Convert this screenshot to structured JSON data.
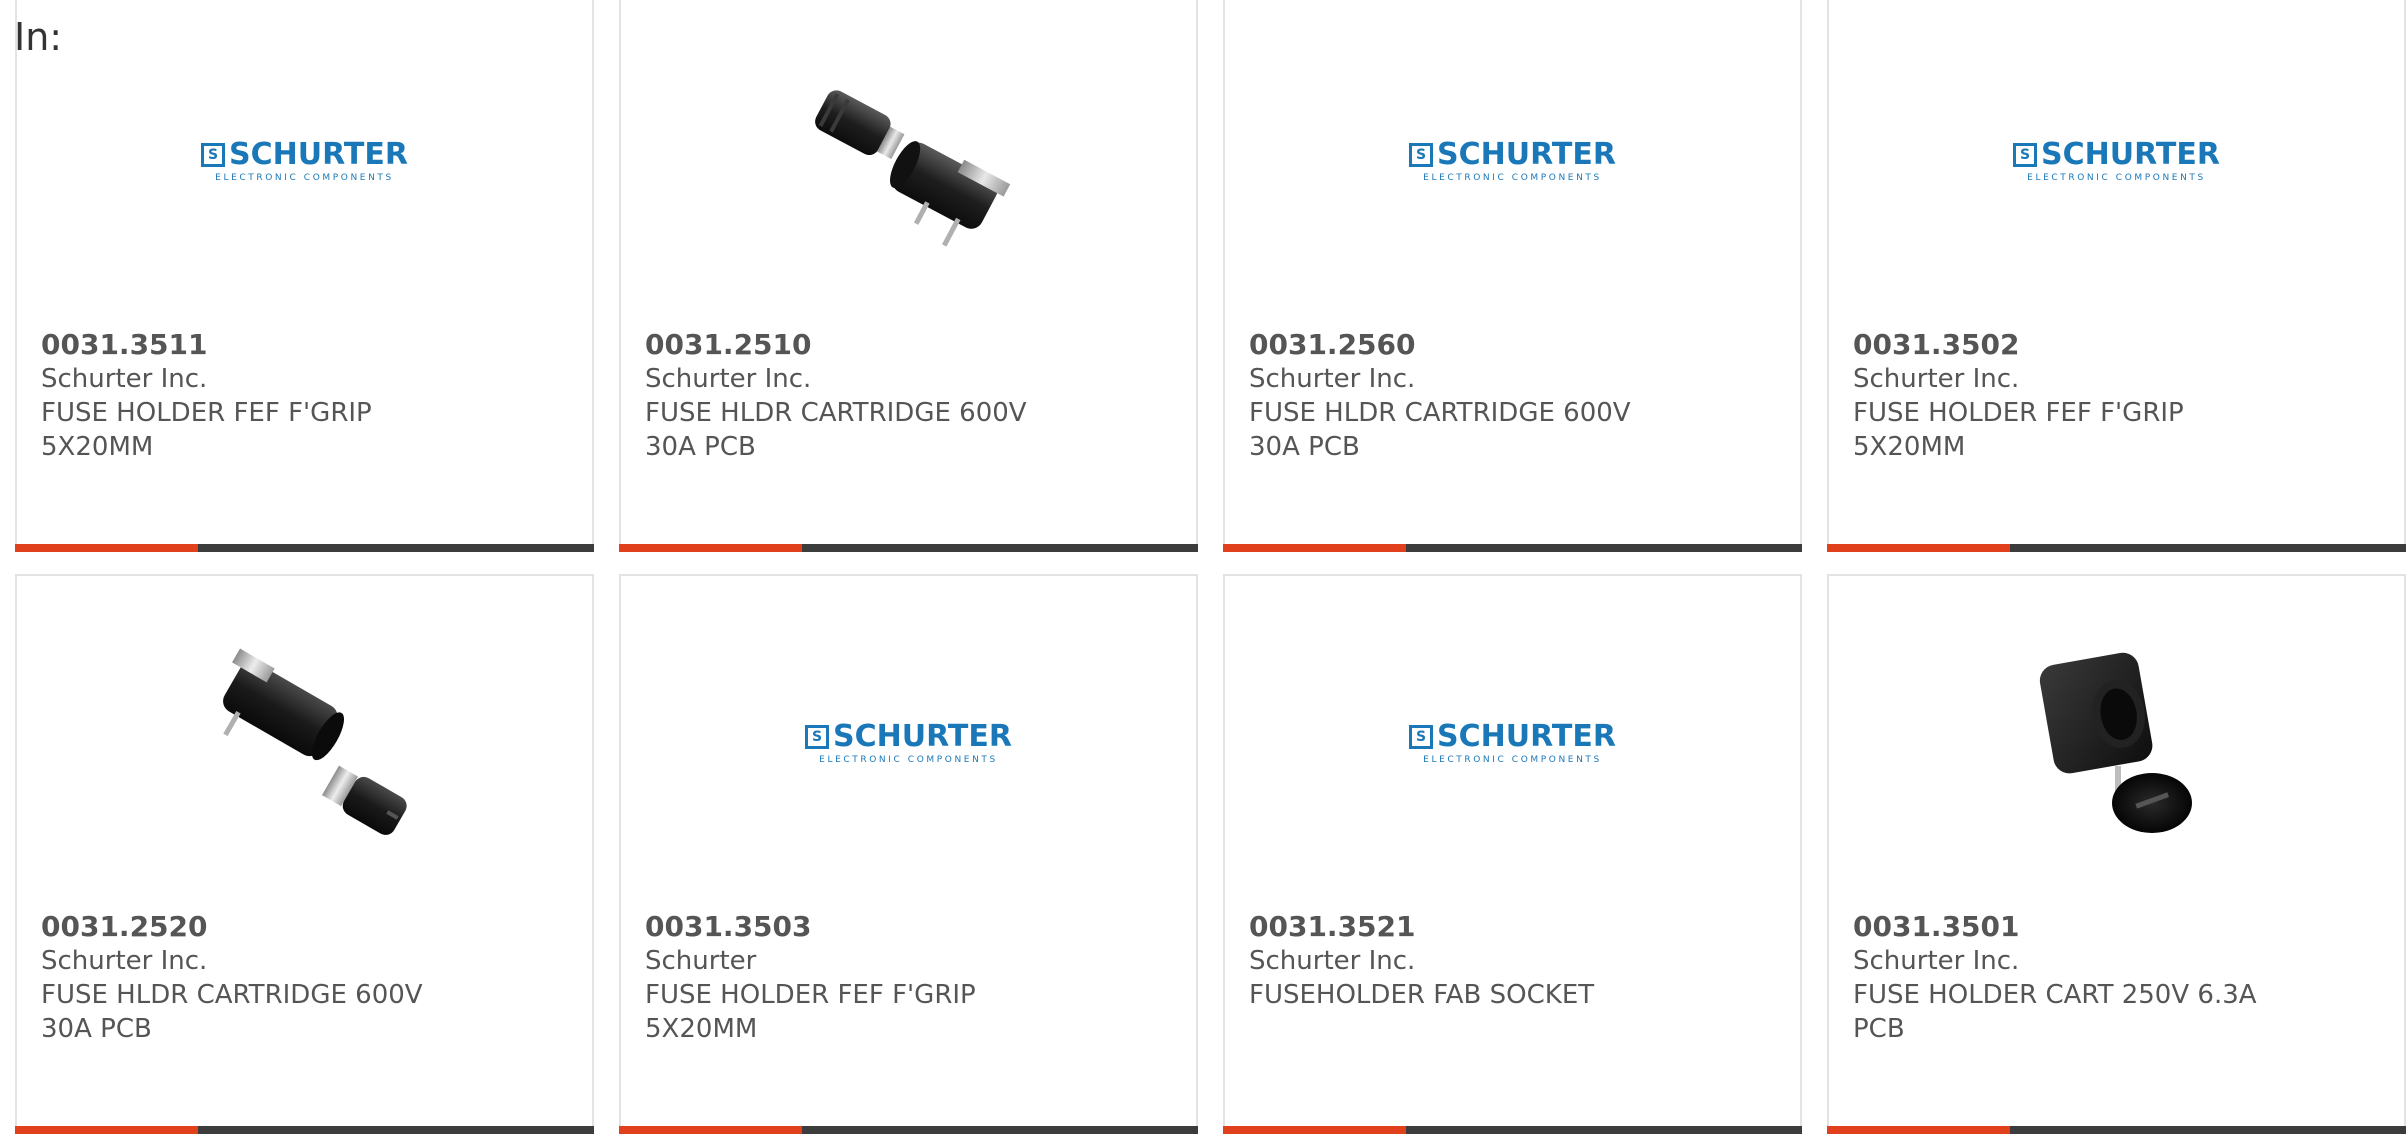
{
  "header": {
    "label": "In:"
  },
  "brand": {
    "logo_word": "SCHURTER",
    "logo_mark": "S",
    "logo_sub": "ELECTRONIC COMPONENTS",
    "color": "#1a78b8"
  },
  "colors": {
    "accent": "#e0401c",
    "bar": "#3c3c3c",
    "text": "#555555",
    "border": "#e3e3e3"
  },
  "products": [
    {
      "part_number": "0031.3511",
      "manufacturer": "Schurter Inc.",
      "description": "FUSE HOLDER FEF F'GRIP 5X20MM",
      "image": "schurter-logo"
    },
    {
      "part_number": "0031.2510",
      "manufacturer": "Schurter Inc.",
      "description": "FUSE HLDR CARTRIDGE 600V 30A PCB",
      "image": "fuse-holder-photo"
    },
    {
      "part_number": "0031.2560",
      "manufacturer": "Schurter Inc.",
      "description": "FUSE HLDR CARTRIDGE 600V 30A PCB",
      "image": "schurter-logo"
    },
    {
      "part_number": "0031.3502",
      "manufacturer": "Schurter Inc.",
      "description": "FUSE HOLDER FEF F'GRIP 5X20MM",
      "image": "schurter-logo"
    },
    {
      "part_number": "0031.2520",
      "manufacturer": "Schurter Inc.",
      "description": "FUSE HLDR CARTRIDGE 600V 30A PCB",
      "image": "fuse-holder-photo"
    },
    {
      "part_number": "0031.3503",
      "manufacturer": "Schurter",
      "description": "FUSE HOLDER FEF F'GRIP 5X20MM",
      "image": "schurter-logo"
    },
    {
      "part_number": "0031.3521",
      "manufacturer": "Schurter Inc.",
      "description": "FUSEHOLDER FAB SOCKET",
      "image": "schurter-logo"
    },
    {
      "part_number": "0031.3501",
      "manufacturer": "Schurter Inc.",
      "description": "FUSE HOLDER CART 250V 6.3A PCB",
      "image": "fuse-socket-photo"
    }
  ]
}
